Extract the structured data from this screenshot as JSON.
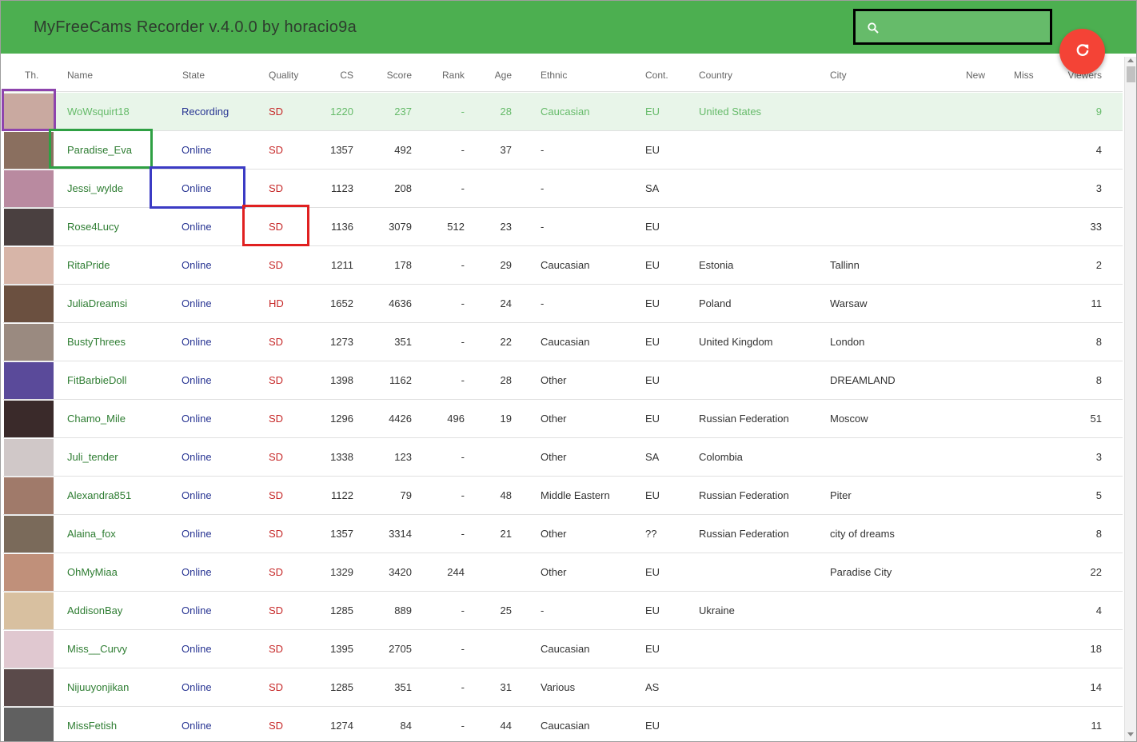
{
  "app": {
    "title": "MyFreeCams Recorder v.4.0.0 by horacio9a"
  },
  "search": {
    "value": "",
    "placeholder": "",
    "icon": "search-icon"
  },
  "fab": {
    "icon": "refresh-icon",
    "color": "#f44336"
  },
  "colors": {
    "header_bg": "#4caf50",
    "search_bg": "#66bb6a",
    "recording_row_bg": "#e8f5e9",
    "name_color": "#2e7d32",
    "state_color": "#283593",
    "quality_color": "#c62828"
  },
  "table": {
    "headers": {
      "thumb": "Th.",
      "name": "Name",
      "state": "State",
      "quality": "Quality",
      "cs": "CS",
      "score": "Score",
      "rank": "Rank",
      "age": "Age",
      "ethnic": "Ethnic",
      "cont": "Cont.",
      "country": "Country",
      "city": "City",
      "new": "New",
      "miss": "Miss",
      "viewers": "Viewers"
    },
    "rows": [
      {
        "name": "WoWsquirt18",
        "state": "Recording",
        "quality": "SD",
        "cs": "1220",
        "score": "237",
        "rank": "-",
        "age": "28",
        "ethnic": "Caucasian",
        "cont": "EU",
        "country": "United States",
        "city": "",
        "new": "",
        "miss": "",
        "viewers": "9"
      },
      {
        "name": "Paradise_Eva",
        "state": "Online",
        "quality": "SD",
        "cs": "1357",
        "score": "492",
        "rank": "-",
        "age": "37",
        "ethnic": "-",
        "cont": "EU",
        "country": "",
        "city": "",
        "new": "",
        "miss": "",
        "viewers": "4"
      },
      {
        "name": "Jessi_wylde",
        "state": "Online",
        "quality": "SD",
        "cs": "1123",
        "score": "208",
        "rank": "-",
        "age": "",
        "ethnic": "-",
        "cont": "SA",
        "country": "",
        "city": "",
        "new": "",
        "miss": "",
        "viewers": "3"
      },
      {
        "name": "Rose4Lucy",
        "state": "Online",
        "quality": "SD",
        "cs": "1136",
        "score": "3079",
        "rank": "512",
        "age": "23",
        "ethnic": "-",
        "cont": "EU",
        "country": "",
        "city": "",
        "new": "",
        "miss": "",
        "viewers": "33"
      },
      {
        "name": "RitaPride",
        "state": "Online",
        "quality": "SD",
        "cs": "1211",
        "score": "178",
        "rank": "-",
        "age": "29",
        "ethnic": "Caucasian",
        "cont": "EU",
        "country": "Estonia",
        "city": "Tallinn",
        "new": "",
        "miss": "",
        "viewers": "2"
      },
      {
        "name": "JuliaDreamsi",
        "state": "Online",
        "quality": "HD",
        "cs": "1652",
        "score": "4636",
        "rank": "-",
        "age": "24",
        "ethnic": "-",
        "cont": "EU",
        "country": "Poland",
        "city": "Warsaw",
        "new": "",
        "miss": "",
        "viewers": "11"
      },
      {
        "name": "BustyThrees",
        "state": "Online",
        "quality": "SD",
        "cs": "1273",
        "score": "351",
        "rank": "-",
        "age": "22",
        "ethnic": "Caucasian",
        "cont": "EU",
        "country": "United Kingdom",
        "city": "London",
        "new": "",
        "miss": "",
        "viewers": "8"
      },
      {
        "name": "FitBarbieDoll",
        "state": "Online",
        "quality": "SD",
        "cs": "1398",
        "score": "1162",
        "rank": "-",
        "age": "28",
        "ethnic": "Other",
        "cont": "EU",
        "country": "",
        "city": "DREAMLAND",
        "new": "",
        "miss": "",
        "viewers": "8"
      },
      {
        "name": "Chamo_Mile",
        "state": "Online",
        "quality": "SD",
        "cs": "1296",
        "score": "4426",
        "rank": "496",
        "age": "19",
        "ethnic": "Other",
        "cont": "EU",
        "country": "Russian Federation",
        "city": "Moscow",
        "new": "",
        "miss": "",
        "viewers": "51"
      },
      {
        "name": "Juli_tender",
        "state": "Online",
        "quality": "SD",
        "cs": "1338",
        "score": "123",
        "rank": "-",
        "age": "",
        "ethnic": "Other",
        "cont": "SA",
        "country": "Colombia",
        "city": "",
        "new": "",
        "miss": "",
        "viewers": "3"
      },
      {
        "name": "Alexandra851",
        "state": "Online",
        "quality": "SD",
        "cs": "1122",
        "score": "79",
        "rank": "-",
        "age": "48",
        "ethnic": "Middle Eastern",
        "cont": "EU",
        "country": "Russian Federation",
        "city": "Piter",
        "new": "",
        "miss": "",
        "viewers": "5"
      },
      {
        "name": "Alaina_fox",
        "state": "Online",
        "quality": "SD",
        "cs": "1357",
        "score": "3314",
        "rank": "-",
        "age": "21",
        "ethnic": "Other",
        "cont": "??",
        "country": "Russian Federation",
        "city": "city of dreams",
        "new": "",
        "miss": "",
        "viewers": "8"
      },
      {
        "name": "OhMyMiaa",
        "state": "Online",
        "quality": "SD",
        "cs": "1329",
        "score": "3420",
        "rank": "244",
        "age": "",
        "ethnic": "Other",
        "cont": "EU",
        "country": "",
        "city": "Paradise City",
        "new": "",
        "miss": "",
        "viewers": "22"
      },
      {
        "name": "AddisonBay",
        "state": "Online",
        "quality": "SD",
        "cs": "1285",
        "score": "889",
        "rank": "-",
        "age": "25",
        "ethnic": "-",
        "cont": "EU",
        "country": "Ukraine",
        "city": "",
        "new": "",
        "miss": "",
        "viewers": "4"
      },
      {
        "name": "Miss__Curvy",
        "state": "Online",
        "quality": "SD",
        "cs": "1395",
        "score": "2705",
        "rank": "-",
        "age": "",
        "ethnic": "Caucasian",
        "cont": "EU",
        "country": "",
        "city": "",
        "new": "",
        "miss": "",
        "viewers": "18"
      },
      {
        "name": "Nijuuyonjikan",
        "state": "Online",
        "quality": "SD",
        "cs": "1285",
        "score": "351",
        "rank": "-",
        "age": "31",
        "ethnic": "Various",
        "cont": "AS",
        "country": "",
        "city": "",
        "new": "",
        "miss": "",
        "viewers": "14"
      },
      {
        "name": "MissFetish",
        "state": "Online",
        "quality": "SD",
        "cs": "1274",
        "score": "84",
        "rank": "-",
        "age": "44",
        "ethnic": "Caucasian",
        "cont": "EU",
        "country": "",
        "city": "",
        "new": "",
        "miss": "",
        "viewers": "11"
      }
    ]
  }
}
